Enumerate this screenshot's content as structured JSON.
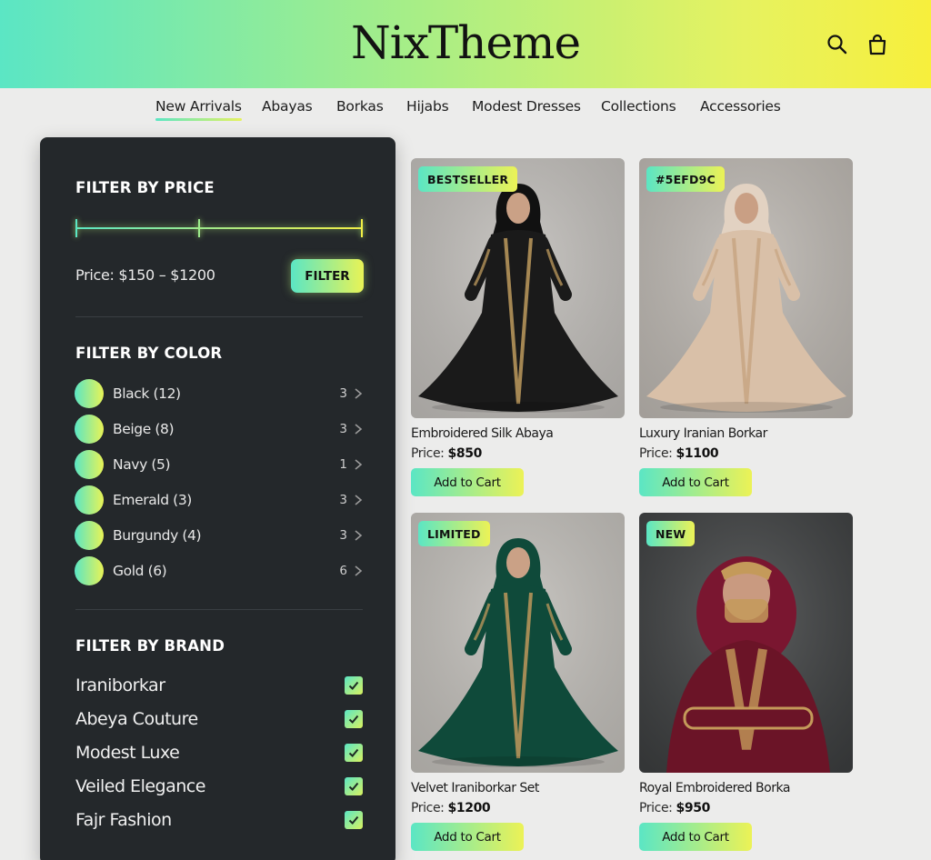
{
  "brand": {
    "logo": "NixTheme"
  },
  "header": {
    "search_icon": "search-icon",
    "bag_icon": "shopping-bag-icon"
  },
  "nav": [
    {
      "label": "New Arrivals",
      "active": true
    },
    {
      "label": "Abayas"
    },
    {
      "label": "Borkas"
    },
    {
      "label": "Hijabs"
    },
    {
      "label": "Modest Dresses"
    },
    {
      "label": "Collections"
    },
    {
      "label": "Accessories"
    }
  ],
  "sidebar": {
    "price": {
      "heading": "FILTER BY PRICE",
      "label": "Price: $150 – $1200",
      "button": "FILTER",
      "range_min_fraction": 0.43,
      "range_max_fraction": 1.0
    },
    "color": {
      "heading": "FILTER BY COLOR",
      "items": [
        {
          "label": "Black (12)",
          "count": "3"
        },
        {
          "label": "Beige (8)",
          "count": "3"
        },
        {
          "label": "Navy (5)",
          "count": "1"
        },
        {
          "label": "Emerald (3)",
          "count": "3"
        },
        {
          "label": "Burgundy (4)",
          "count": "3"
        },
        {
          "label": "Gold (6)",
          "count": "6"
        }
      ]
    },
    "brand": {
      "heading": "FILTER BY BRAND",
      "items": [
        {
          "label": "Iraniborkar",
          "checked": true
        },
        {
          "label": "Abeya Couture",
          "checked": true
        },
        {
          "label": "Modest Luxe",
          "checked": true
        },
        {
          "label": "Veiled Elegance",
          "checked": true
        },
        {
          "label": "Fajr Fashion",
          "checked": true
        }
      ]
    }
  },
  "products": [
    {
      "badge": "BESTSELLER",
      "name": "Embroidered Silk Abaya",
      "price_prefix": "Price:",
      "price": "$850",
      "button": "Add to Cart",
      "bg": "#bdbab6",
      "dress": "#1a1a1a",
      "accent": "#b5945a",
      "hijab": "#111111",
      "skin": "#caa186"
    },
    {
      "badge": "#5EFD9C",
      "name": "Luxury Iranian Borkar",
      "price_prefix": "Price:",
      "price": "$1100",
      "button": "Add to Cart",
      "bg": "#b9b4ae",
      "dress": "#d9c0a8",
      "accent": "#c8a684",
      "hijab": "#e2d2c2",
      "skin": "#c99f84"
    },
    {
      "badge": "LIMITED",
      "name": "Velvet Iraniborkar Set",
      "price_prefix": "Price:",
      "price": "$1200",
      "button": "Add to Cart",
      "bg": "#bebbb6",
      "dress": "#0f4a3a",
      "accent": "#b5945a",
      "hijab": "#0f4a3a",
      "skin": "#caa186"
    },
    {
      "badge": "NEW",
      "name": "Royal Embroidered Borka",
      "price_prefix": "Price:",
      "price": "$950",
      "button": "Add to Cart",
      "bg": "#3b3d3e",
      "dress": "#6b1427",
      "accent": "#c49a5a",
      "hijab": "#7a1630",
      "skin": "#c99a80"
    }
  ]
}
